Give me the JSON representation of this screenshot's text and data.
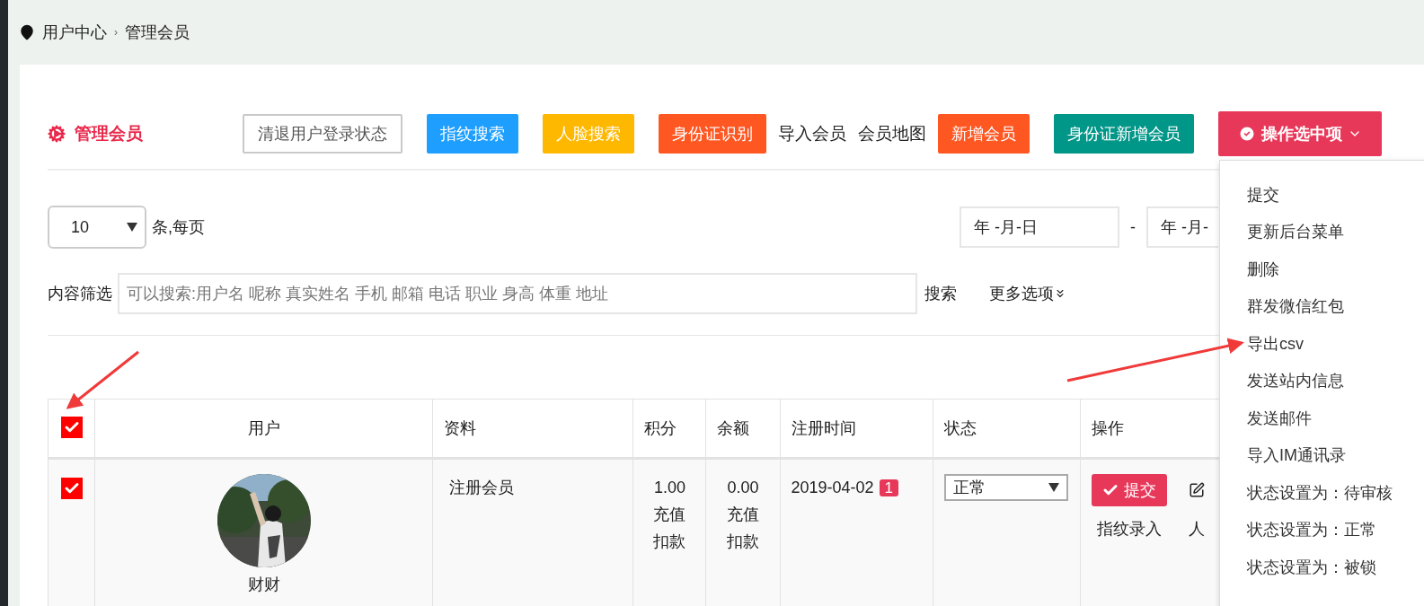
{
  "breadcrumb": {
    "items": [
      "用户中心",
      "管理会员"
    ],
    "separator": "›"
  },
  "panel": {
    "title": "管理会员"
  },
  "toolbar": [
    {
      "kind": "outline",
      "label": "清退用户登录状态"
    },
    {
      "kind": "button",
      "label": "指纹搜索",
      "color": "#1e9fff"
    },
    {
      "kind": "button",
      "label": "人脸搜索",
      "color": "#ffb800"
    },
    {
      "kind": "button",
      "label": "身份证识别",
      "color": "#ff5722"
    },
    {
      "kind": "text",
      "label": "导入会员"
    },
    {
      "kind": "text",
      "label": "会员地图"
    },
    {
      "kind": "button",
      "label": "新增会员",
      "color": "#ff5722"
    },
    {
      "kind": "button",
      "label": "身份证新增会员",
      "color": "#009688"
    }
  ],
  "action_menu": {
    "label": "操作选中项",
    "expanded": true,
    "items": [
      "提交",
      "更新后台菜单",
      "删除",
      "群发微信红包",
      "导出csv",
      "发送站内信息",
      "发送邮件",
      "导入IM通讯录",
      "状态设置为：待审核",
      "状态设置为：正常",
      "状态设置为：被锁"
    ]
  },
  "page_size": {
    "value": "10",
    "suffix": "条,每页"
  },
  "date_range": {
    "start": "年 -月-日",
    "separator": "-",
    "end": "年 -月-"
  },
  "filter": {
    "label": "内容筛选",
    "placeholder": "可以搜索:用户名 呢称 真实姓名 手机 邮箱 电话 职业 身高 体重 地址",
    "search": "搜索",
    "more": "更多选项"
  },
  "table": {
    "select_all": true,
    "columns": [
      "用户",
      "资料",
      "积分",
      "余额",
      "注册时间",
      "状态",
      "操作"
    ],
    "rows": [
      {
        "selected": true,
        "user": "财财",
        "avatar": {
          "kind": "picture"
        },
        "profile": "注册会员",
        "points": [
          "1.00",
          "充值",
          "扣款"
        ],
        "balance": [
          "0.00",
          "充值",
          "扣款"
        ],
        "registered": "2019-04-02",
        "badge": "1",
        "status": "正常",
        "submit": "提交",
        "links": [
          "指纹录入",
          "人"
        ]
      }
    ]
  }
}
